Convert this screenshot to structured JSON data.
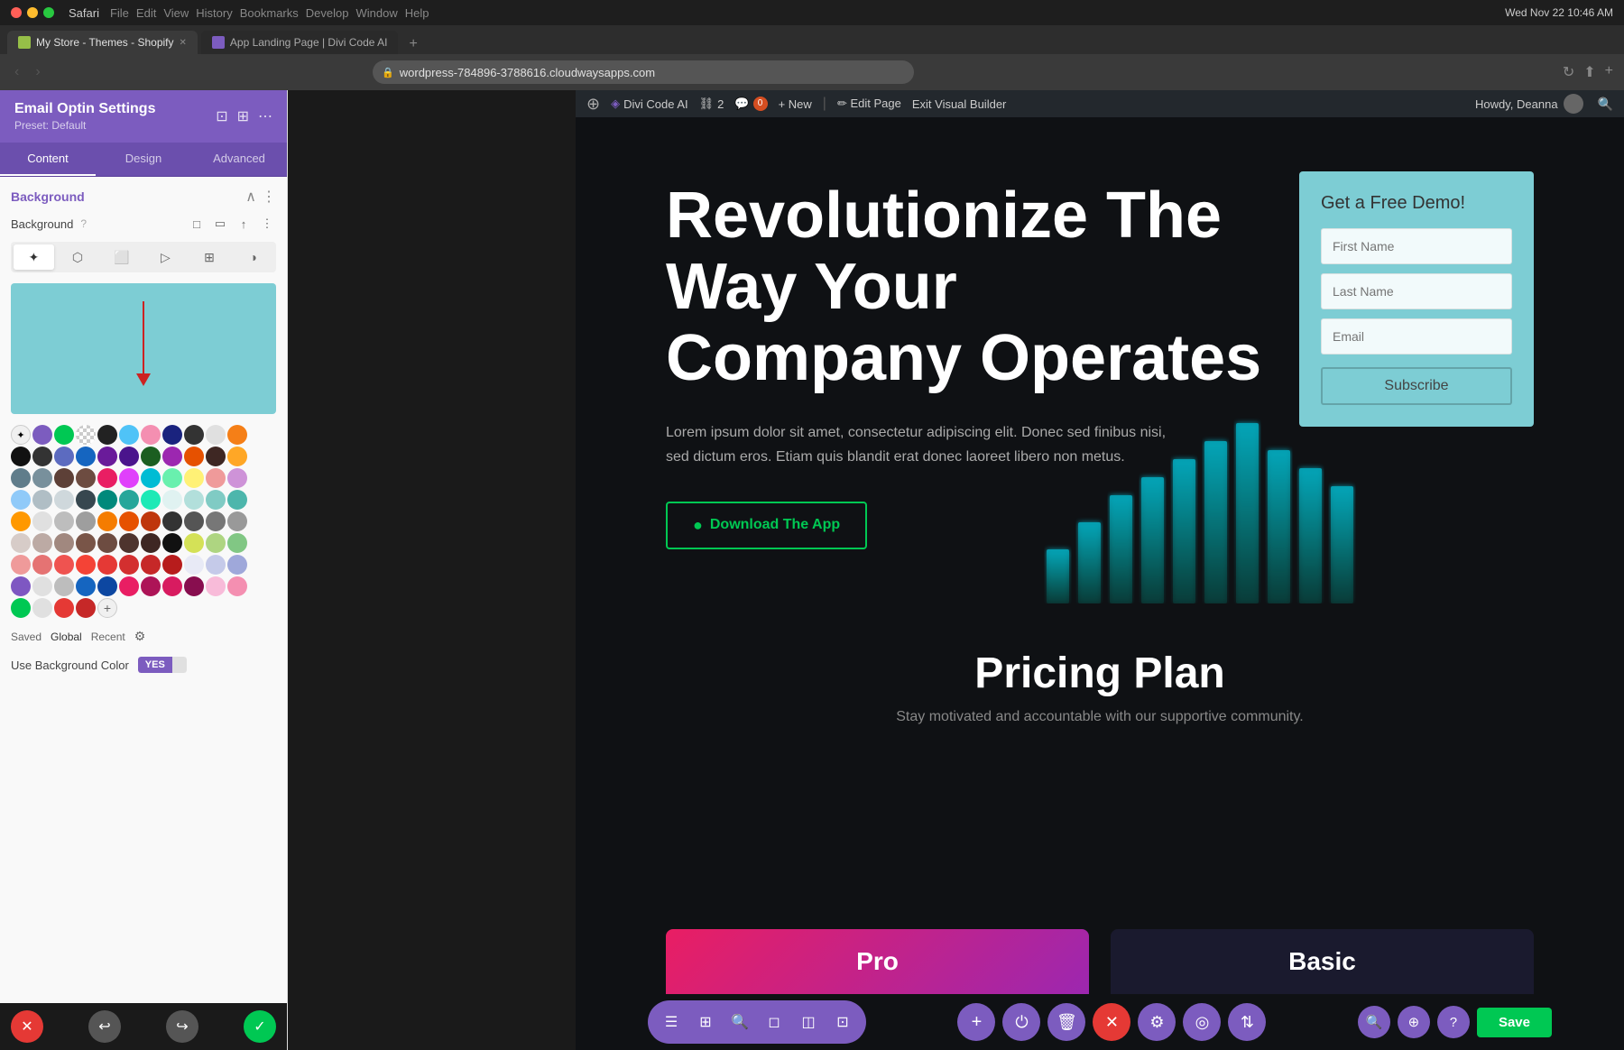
{
  "macbar": {
    "app": "Safari",
    "menus": [
      "Safari",
      "File",
      "Edit",
      "View",
      "History",
      "Bookmarks",
      "Develop",
      "Window",
      "Help"
    ],
    "time": "Wed Nov 22  10:46 AM"
  },
  "browser": {
    "tab1": {
      "label": "My Store - Themes - Shopify",
      "favicon_color": "#96bf48"
    },
    "tab2": {
      "label": "App Landing Page | Divi Code AI"
    },
    "url": "wordpress-784896-3788616.cloudwaysapps.com"
  },
  "sidebar": {
    "title": "Email Optin Settings",
    "preset": "Preset: Default",
    "tabs": [
      "Content",
      "Design",
      "Advanced"
    ],
    "active_tab": "Content",
    "section_title": "Background",
    "bg_label": "Background",
    "type_buttons": [
      "gradient",
      "color",
      "image",
      "video",
      "pattern",
      "mask"
    ],
    "color_preview": "#7dcdd4",
    "use_bg_label": "Use Background Color",
    "toggle_yes": "YES",
    "toggle_no": "",
    "footer_labels": [
      "Saved",
      "Global",
      "Recent"
    ]
  },
  "wpbar": {
    "items": [
      {
        "label": "Divi Code AI",
        "icon": "divi"
      },
      {
        "label": "2",
        "icon": "link"
      },
      {
        "label": "0",
        "icon": "comment"
      },
      {
        "label": "+ New"
      },
      {
        "label": "Edit Page"
      },
      {
        "label": "Exit Visual Builder"
      }
    ],
    "howdy": "Howdy, Deanna"
  },
  "hero": {
    "title": "Revolutionize The Way Your Company Operates",
    "description": "Lorem ipsum dolor sit amet, consectetur adipiscing elit. Donec sed finibus nisi, sed dictum eros. Etiam quis blandit erat donec laoreet libero non metus.",
    "button_label": "Download The App",
    "button_icon": "●"
  },
  "demo_form": {
    "title": "Get a Free Demo!",
    "fields": [
      {
        "placeholder": "First Name"
      },
      {
        "placeholder": "Last Name"
      },
      {
        "placeholder": "Email"
      }
    ],
    "submit_label": "Subscribe"
  },
  "pricing": {
    "title": "Pricing Plan",
    "subtitle": "Stay motivated and accountable with our supportive community.",
    "cards": [
      {
        "title": "Pro"
      },
      {
        "title": "Basic"
      }
    ]
  },
  "toolbar": {
    "left_btns": [
      "☰",
      "⊞",
      "🔍",
      "◻",
      "◫",
      "▦"
    ],
    "center_btns": [
      "+",
      "⏻",
      "🗑",
      "✕",
      "⚙",
      "◎",
      "⇅"
    ],
    "right_btns": [
      "🔍",
      "⊕",
      "?"
    ],
    "save_label": "Save"
  },
  "swatches": {
    "row1": [
      "#7c5cbf",
      "#00c853",
      "#e0e0e0",
      "#222",
      "#888",
      "#4fc3f7",
      "#f48fb1",
      "#1a237e",
      "#333",
      "#e0e0e0"
    ],
    "row2": [
      "#111",
      "#333",
      "#5c6bc0",
      "#1565c0",
      "#6a1b9a",
      "#4a148c",
      "#1b5e20",
      "#f57f17",
      "#e65100"
    ],
    "row3": [
      "#607d8b",
      "#78909c",
      "#5d4037",
      "#6d4c41",
      "#e91e63",
      "#e040fb",
      "#00bcd4",
      "#69f0ae",
      "#fff176"
    ],
    "row4": [
      "#90caf9",
      "#b0bec5",
      "#cfd8dc",
      "#37474f",
      "#00897b",
      "#26a69a",
      "#1de9b6"
    ],
    "row5": [
      "#ff9800",
      "#e0e0e0",
      "#bdbdbd",
      "#9e9e9e",
      "#f57c00",
      "#e65100",
      "#bf360c",
      "#333"
    ],
    "row6": [
      "#d7ccc8",
      "#bcaaa4",
      "#a1887f",
      "#795548",
      "#6d4c41",
      "#4e342e",
      "#3e2723",
      "#111"
    ],
    "row7": [
      "#ef9a9a",
      "#e57373",
      "#ef5350",
      "#f44336",
      "#e53935",
      "#d32f2f",
      "#c62828",
      "#b71c1c"
    ],
    "row8": [
      "#7e57c2",
      "#e0e0e0",
      "#bdbdbd",
      "#1565c0",
      "#0d47a1",
      "#e91e63",
      "#ad1457",
      "#d81b60"
    ],
    "row9": [
      "#00c853",
      "#e0e0e0",
      "#e53935",
      "#c62828"
    ]
  }
}
